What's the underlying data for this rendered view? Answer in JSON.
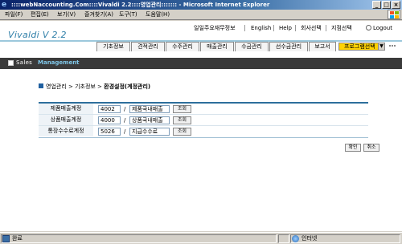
{
  "window": {
    "title": "::::webNaccounting.Com::::Vivaldi 2.2::::영업관리::::::: - Microsoft Internet Explorer",
    "minimize": "_",
    "maximize": "□",
    "close": "×"
  },
  "ie_menu": [
    "파일(F)",
    "편집(E)",
    "보기(V)",
    "즐겨찾기(A)",
    "도구(T)",
    "도움말(H)"
  ],
  "brand": "Vivaldi  V 2.2",
  "top_links": [
    "일일주요재무정보",
    "English",
    "Help",
    "회사선택",
    "지점선택"
  ],
  "logout_label": "Logout",
  "menu_tabs": [
    "기초정보",
    "견적관리",
    "수주관리",
    "매출관리",
    "수금관리",
    "선수금관리",
    "보고서"
  ],
  "program_select": "프로그램선택",
  "module_bar": {
    "first": "Sales",
    "second": "Management"
  },
  "breadcrumb": {
    "path": "영업관리 > 기초정보 >",
    "current": "환경설정(계정관리)"
  },
  "form_rows": [
    {
      "label": "제품매출계정",
      "code": "4002",
      "name": "제품국내매출",
      "button": "조회"
    },
    {
      "label": "상품매출계정",
      "code": "4000",
      "name": "상품국내매출",
      "button": "조회"
    },
    {
      "label": "통장수수료계정",
      "code": "5026",
      "name": "지급수수료",
      "button": "조회"
    }
  ],
  "slash": "/",
  "actions": {
    "confirm": "확인",
    "cancel": "취소"
  },
  "status": {
    "done": "완료",
    "zone": "인터넷"
  },
  "colors": {
    "brand": "#2f7fa8",
    "accent_bar": "#3a3a3a",
    "program_select": "#ffd200"
  }
}
